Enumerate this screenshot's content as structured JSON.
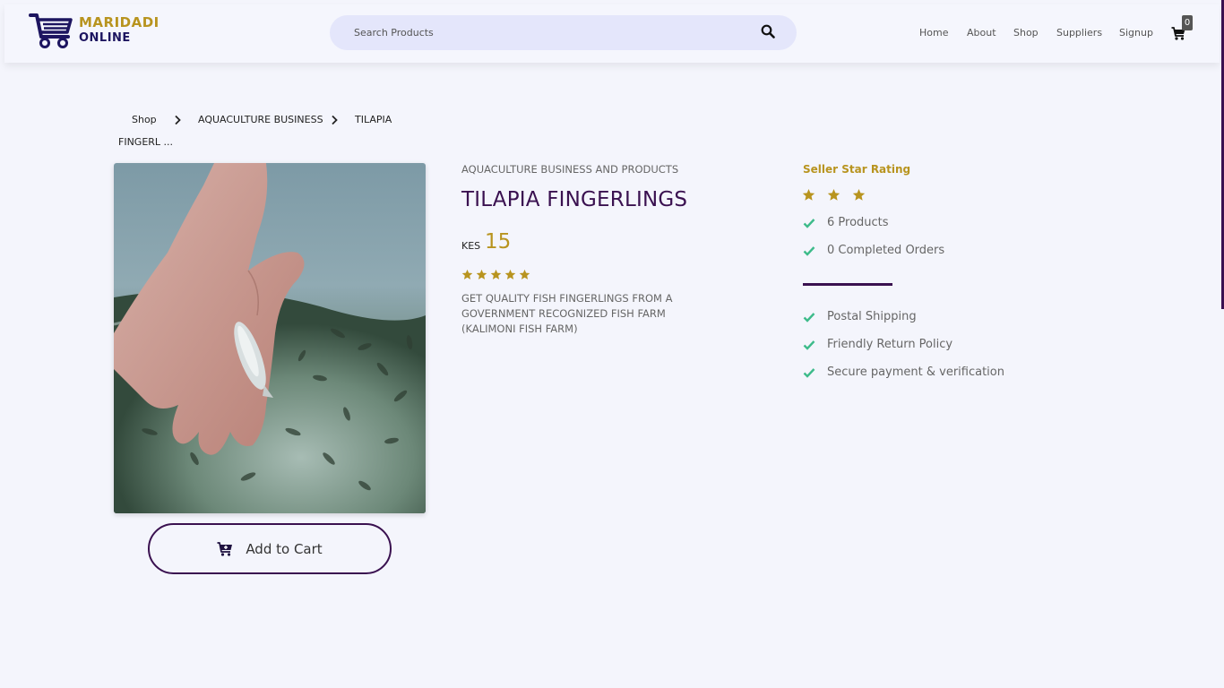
{
  "header": {
    "logo_line1": "MARIDADI",
    "logo_line2": "ONLINE",
    "search_placeholder": "Search Products",
    "nav": [
      "Home",
      "About",
      "Shop",
      "Suppliers",
      "Signup"
    ],
    "cart_count": "0"
  },
  "breadcrumb": {
    "items": [
      "Shop",
      "AQUACULTURE BUSINESS",
      "TILAPIA",
      "FINGERL ..."
    ]
  },
  "product": {
    "category": "AQUACULTURE BUSINESS AND PRODUCTS",
    "title": "TILAPIA FINGERLINGS",
    "currency": "KES",
    "price": "15",
    "rating": 5,
    "description": "GET QUALITY FISH FINGERLINGS FROM A GOVERNMENT RECOGNIZED FISH FARM (KALIMONI FISH FARM)",
    "add_to_cart_label": "Add to Cart"
  },
  "seller": {
    "title": "Seller Star Rating",
    "stars": 3,
    "products": "6 Products",
    "orders": "0 Completed Orders"
  },
  "features": [
    "Postal Shipping",
    "Friendly Return Policy",
    "Secure payment & verification"
  ],
  "colors": {
    "accent_gold": "#b8941f",
    "accent_purple": "#3a1150",
    "check_green": "#3dbb8a",
    "page_bg": "#f4f5fc"
  }
}
